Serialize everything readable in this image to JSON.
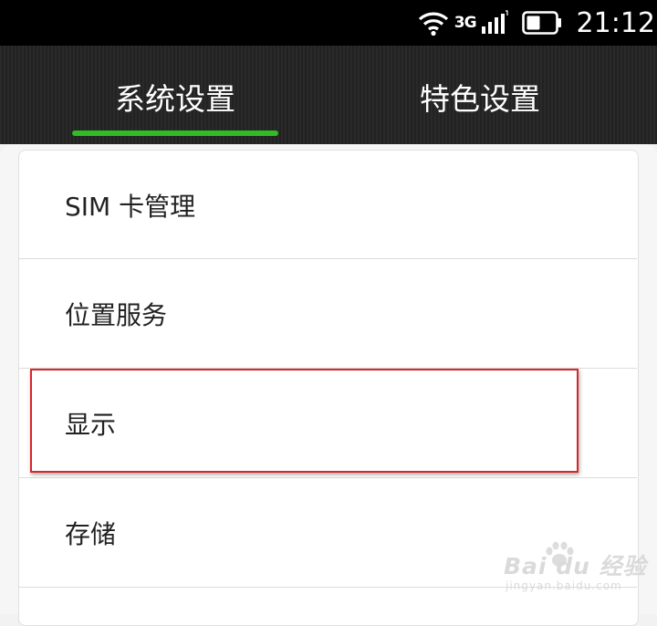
{
  "status_bar": {
    "network_type": "3G",
    "time": "21:12",
    "icons": [
      "wifi-icon",
      "signal-icon",
      "battery-icon"
    ]
  },
  "tabs": [
    {
      "label": "系统设置",
      "active": true
    },
    {
      "label": "特色设置",
      "active": false
    }
  ],
  "colors": {
    "tab_indicator": "#2fbc24",
    "highlight": "#d8262a"
  },
  "settings_items": [
    {
      "label": "SIM 卡管理"
    },
    {
      "label": "位置服务"
    },
    {
      "label": "显示"
    },
    {
      "label": "存储"
    }
  ],
  "watermark": {
    "brand": "Bai du 经验",
    "url": "jingyan.baidu.com"
  }
}
